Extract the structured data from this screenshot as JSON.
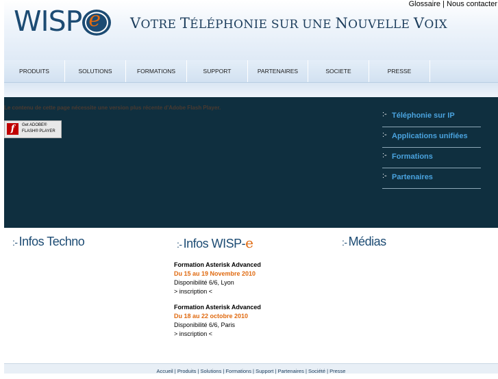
{
  "header": {
    "logo_text": "WISP",
    "logo_letter": "e",
    "tagline_parts": [
      "V",
      "OTRE ",
      "T",
      "ÉLÉPHONIE SUR UNE ",
      "N",
      "OUVELLE ",
      "V",
      "OIX"
    ],
    "top_links": {
      "glossary": "Glossaire",
      "sep": " | ",
      "contact": "Nous contacter"
    }
  },
  "nav": {
    "items": [
      "PRODUITS",
      "SOLUTIONS",
      "FORMATIONS",
      "SUPPORT",
      "PARTENAIRES",
      "SOCIETE",
      "PRESSE"
    ]
  },
  "banner": {
    "flash_message": "Le contenu de cette page nécessite une version plus récente d'Adobe Flash Player.",
    "flash_button_line1": "Get ADOBE®",
    "flash_button_line2": "FLASH® PLAYER",
    "side_menu": [
      "Téléphonie sur IP",
      "Applications unifiées",
      "Formations",
      "Partenaires"
    ]
  },
  "sections": {
    "techno_title": "Infos Techno",
    "wisp_title": "Infos WISP-",
    "wisp_title_e": "e",
    "medias_title": "Médias",
    "bullet": ":-",
    "news": [
      {
        "title": "Formation Asterisk Advanced",
        "date": "Du 15 au 19 Novembre 2010",
        "info": "Disponibilité 6/6, Lyon",
        "signup": "> inscription <"
      },
      {
        "title": "Formation Asterisk Advanced",
        "date": "Du 18 au 22 octobre 2010",
        "info": "Disponibilité 6/6, Paris",
        "signup": "> inscription <"
      }
    ]
  },
  "footer": {
    "links": [
      "Accueil",
      "Produits",
      "Solutions",
      "Formations",
      "Support",
      "Partenaires",
      "Société",
      "Presse"
    ],
    "sep": " | "
  },
  "colors": {
    "brand_blue": "#1c4b73",
    "accent_orange": "#e06a10",
    "banner_bg": "#0f2f3f",
    "side_link": "#4aa3df"
  }
}
